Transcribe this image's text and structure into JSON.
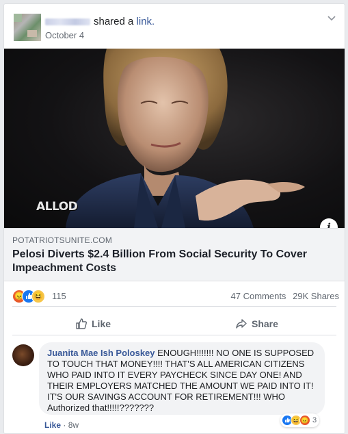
{
  "post": {
    "shared_text": "shared a",
    "shared_link": "link.",
    "date": "October 4"
  },
  "link_preview": {
    "watermark": "ALLOD",
    "domain": "POTATRIOTSUNITE.COM",
    "title": "Pelosi Diverts $2.4 Billion From Social Security To Cover Impeachment Costs"
  },
  "stats": {
    "reaction_count": "115",
    "comments": "47 Comments",
    "shares": "29K Shares",
    "reaction_icons": [
      "angry-icon",
      "like-icon",
      "haha-icon"
    ]
  },
  "actions": {
    "like_label": "Like",
    "share_label": "Share"
  },
  "comment": {
    "author": "Juanita Mae Ish Poloskey",
    "text": "ENOUGH!!!!!!! NO ONE IS SUPPOSED TO TOUCH THAT MONEY!!!! THAT'S ALL AMERICAN CITIZENS WHO PAID INTO IT EVERY PAYCHECK SINCE DAY ONE! AND THEIR EMPLOYERS MATCHED THE AMOUNT WE PAID INTO IT! IT'S OUR SAVINGS ACCOUNT FOR RETIREMENT!!! WHO Authorized that!!!!!???????",
    "reaction_count": "3",
    "like_label": "Like",
    "age": "8w"
  },
  "colors": {
    "link_blue": "#385898",
    "like_blue": "#1877f2",
    "muted": "#606770"
  }
}
